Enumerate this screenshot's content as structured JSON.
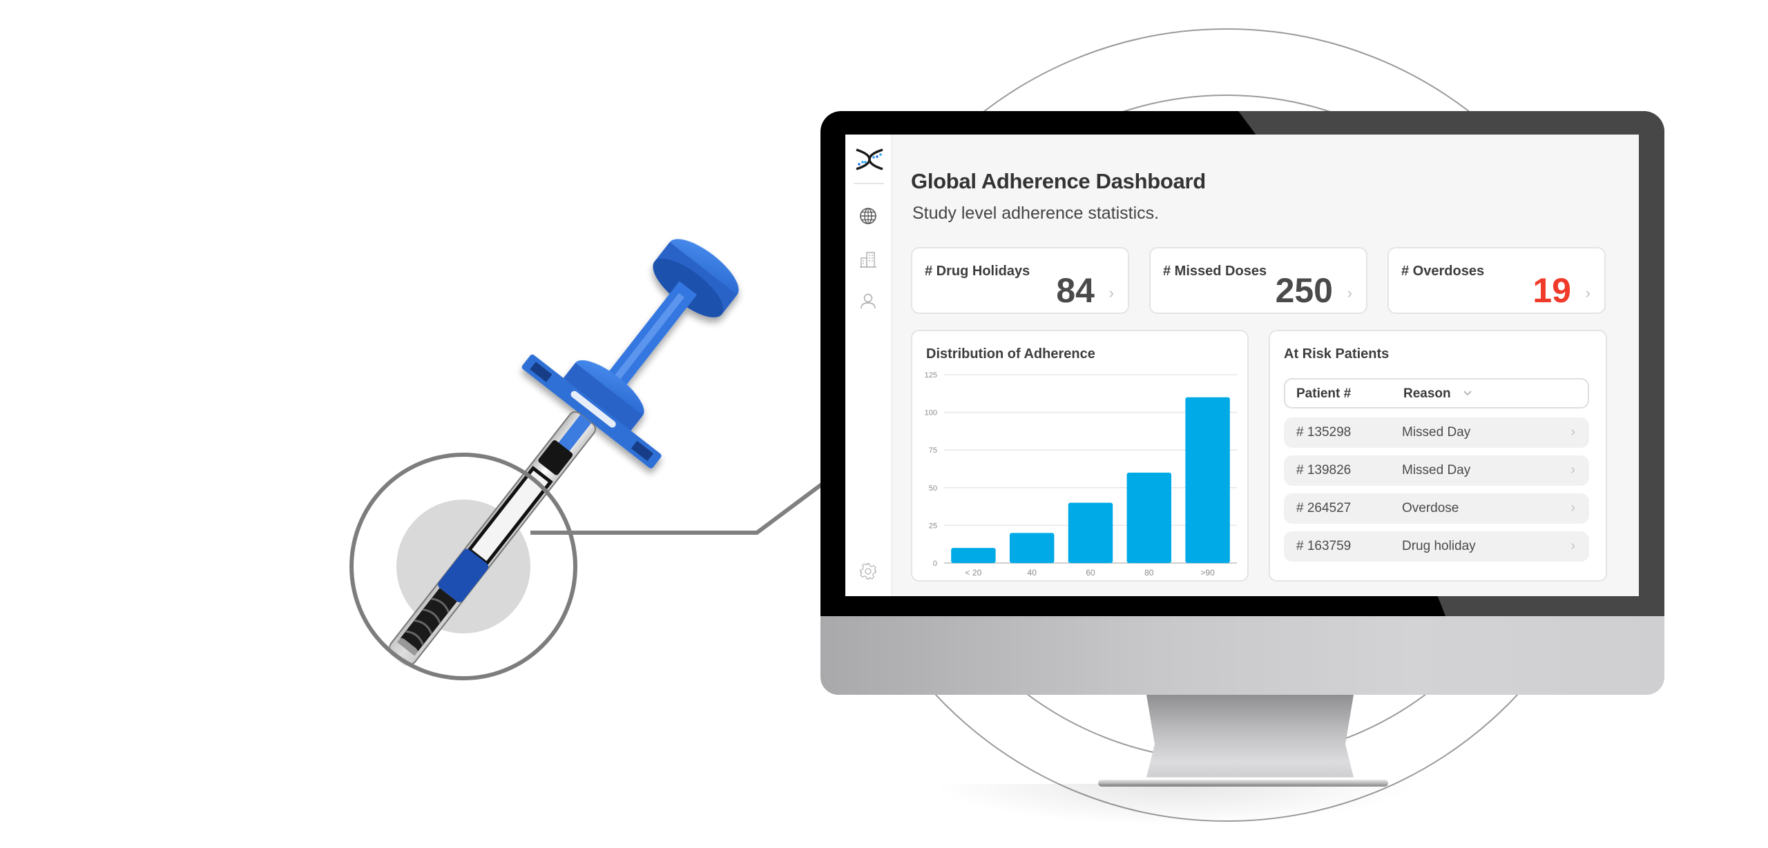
{
  "dashboard": {
    "title": "Global Adherence Dashboard",
    "subtitle": "Study level adherence statistics."
  },
  "sidebar": {
    "logo": "helix-logo",
    "items": [
      {
        "icon": "globe-icon",
        "label": "Global",
        "active": true
      },
      {
        "icon": "building-icon",
        "label": "Sites",
        "active": false
      },
      {
        "icon": "user-icon",
        "label": "Patients",
        "active": false
      }
    ],
    "footer_icon": "gear-icon"
  },
  "stats": [
    {
      "label": "# Drug Holidays",
      "value": "84",
      "chevron": "›",
      "color": "#4a4a4a"
    },
    {
      "label": "# Missed Doses",
      "value": "250",
      "chevron": "›",
      "color": "#4a4a4a"
    },
    {
      "label": "# Overdoses",
      "value": "19",
      "chevron": "›",
      "color": "#f03a2a"
    }
  ],
  "chart_data": {
    "type": "bar",
    "title": "Distribution of Adherence",
    "categories": [
      "< 20",
      "40",
      "60",
      "80",
      ">90"
    ],
    "values": [
      10,
      20,
      40,
      60,
      110
    ],
    "xlabel": "",
    "ylabel": "",
    "ylim": [
      0,
      125
    ],
    "yticks": [
      0,
      25,
      50,
      75,
      100,
      125
    ],
    "grid": true,
    "bar_color": "#00aae6"
  },
  "at_risk": {
    "title": "At Risk Patients",
    "columns": [
      "Patient #",
      "Reason"
    ],
    "sort_icon": "chevron-down-icon",
    "rows": [
      {
        "patient": "# 135298",
        "reason": "Missed Day"
      },
      {
        "patient": "# 139826",
        "reason": "Missed Day"
      },
      {
        "patient": "# 264527",
        "reason": "Overdose"
      },
      {
        "patient": "# 163759",
        "reason": "Drug holiday"
      }
    ],
    "row_chevron": "›"
  },
  "colors": {
    "accent_blue": "#00aae6",
    "alert_red": "#f03a2a",
    "device_blue": "#2f6fd6"
  }
}
